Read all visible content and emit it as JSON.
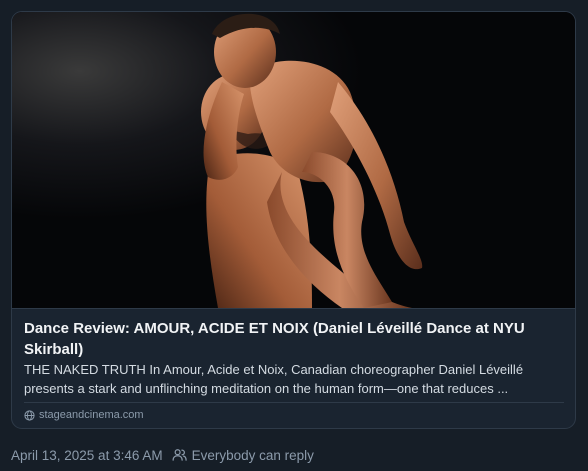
{
  "embed": {
    "title": "Dance Review: AMOUR, ACIDE ET NOIX (Daniel Léveillé Dance at NYU Skirball)",
    "description": "THE NAKED TRUTH In Amour, Acide et Noix, Canadian choreographer Daniel Léveillé presents a stark and unflinching meditation on the human form—one that reduces ...",
    "domain": "stageandcinema.com",
    "domain_icon": "globe-icon"
  },
  "post_meta": {
    "timestamp": "April 13, 2025 at 3:46 AM",
    "reply_setting": "Everybody can reply",
    "reply_icon": "people-icon"
  },
  "colors": {
    "background": "#161e27",
    "card_border": "#2e3a48",
    "title": "#f1f3f5",
    "description": "#d4dbe2",
    "muted": "#8c9bab"
  }
}
